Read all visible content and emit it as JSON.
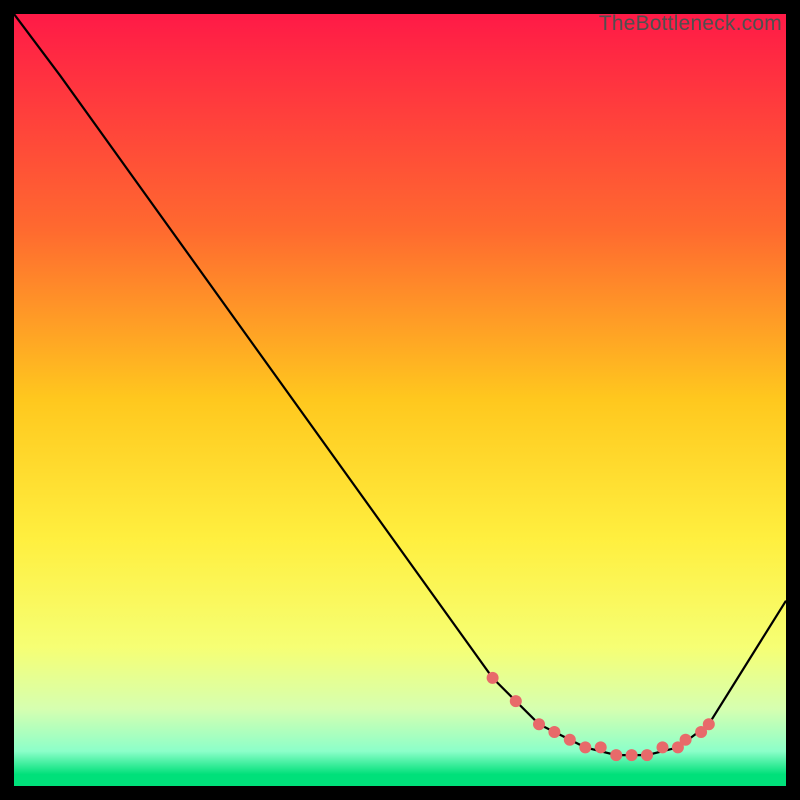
{
  "watermark": "TheBottleneck.com",
  "chart_data": {
    "type": "line",
    "title": "",
    "xlabel": "",
    "ylabel": "",
    "xlim": [
      0,
      100
    ],
    "ylim": [
      0,
      100
    ],
    "grid": false,
    "legend": false,
    "gradient_stops": [
      {
        "offset": 0,
        "color": "#ff1a47"
      },
      {
        "offset": 0.28,
        "color": "#ff6a2f"
      },
      {
        "offset": 0.5,
        "color": "#ffc81e"
      },
      {
        "offset": 0.68,
        "color": "#ffef3f"
      },
      {
        "offset": 0.82,
        "color": "#f6ff74"
      },
      {
        "offset": 0.9,
        "color": "#d6ffb0"
      },
      {
        "offset": 0.955,
        "color": "#8cffc9"
      },
      {
        "offset": 0.985,
        "color": "#00e07a"
      },
      {
        "offset": 1.0,
        "color": "#00e07a"
      }
    ],
    "series": [
      {
        "name": "bottleneck-curve",
        "stroke": "#000000",
        "x": [
          0,
          6,
          62,
          68,
          74,
          78,
          82,
          86,
          90,
          100
        ],
        "y": [
          100,
          92,
          14,
          8,
          5,
          4,
          4,
          5,
          8,
          24
        ]
      }
    ],
    "markers": {
      "name": "curve-dots",
      "color": "#e86a6a",
      "radius": 6,
      "x": [
        62,
        65,
        68,
        70,
        72,
        74,
        76,
        78,
        80,
        82,
        84,
        86,
        87,
        89,
        90
      ],
      "y": [
        14,
        11,
        8,
        7,
        6,
        5,
        5,
        4,
        4,
        4,
        5,
        5,
        6,
        7,
        8
      ]
    }
  }
}
